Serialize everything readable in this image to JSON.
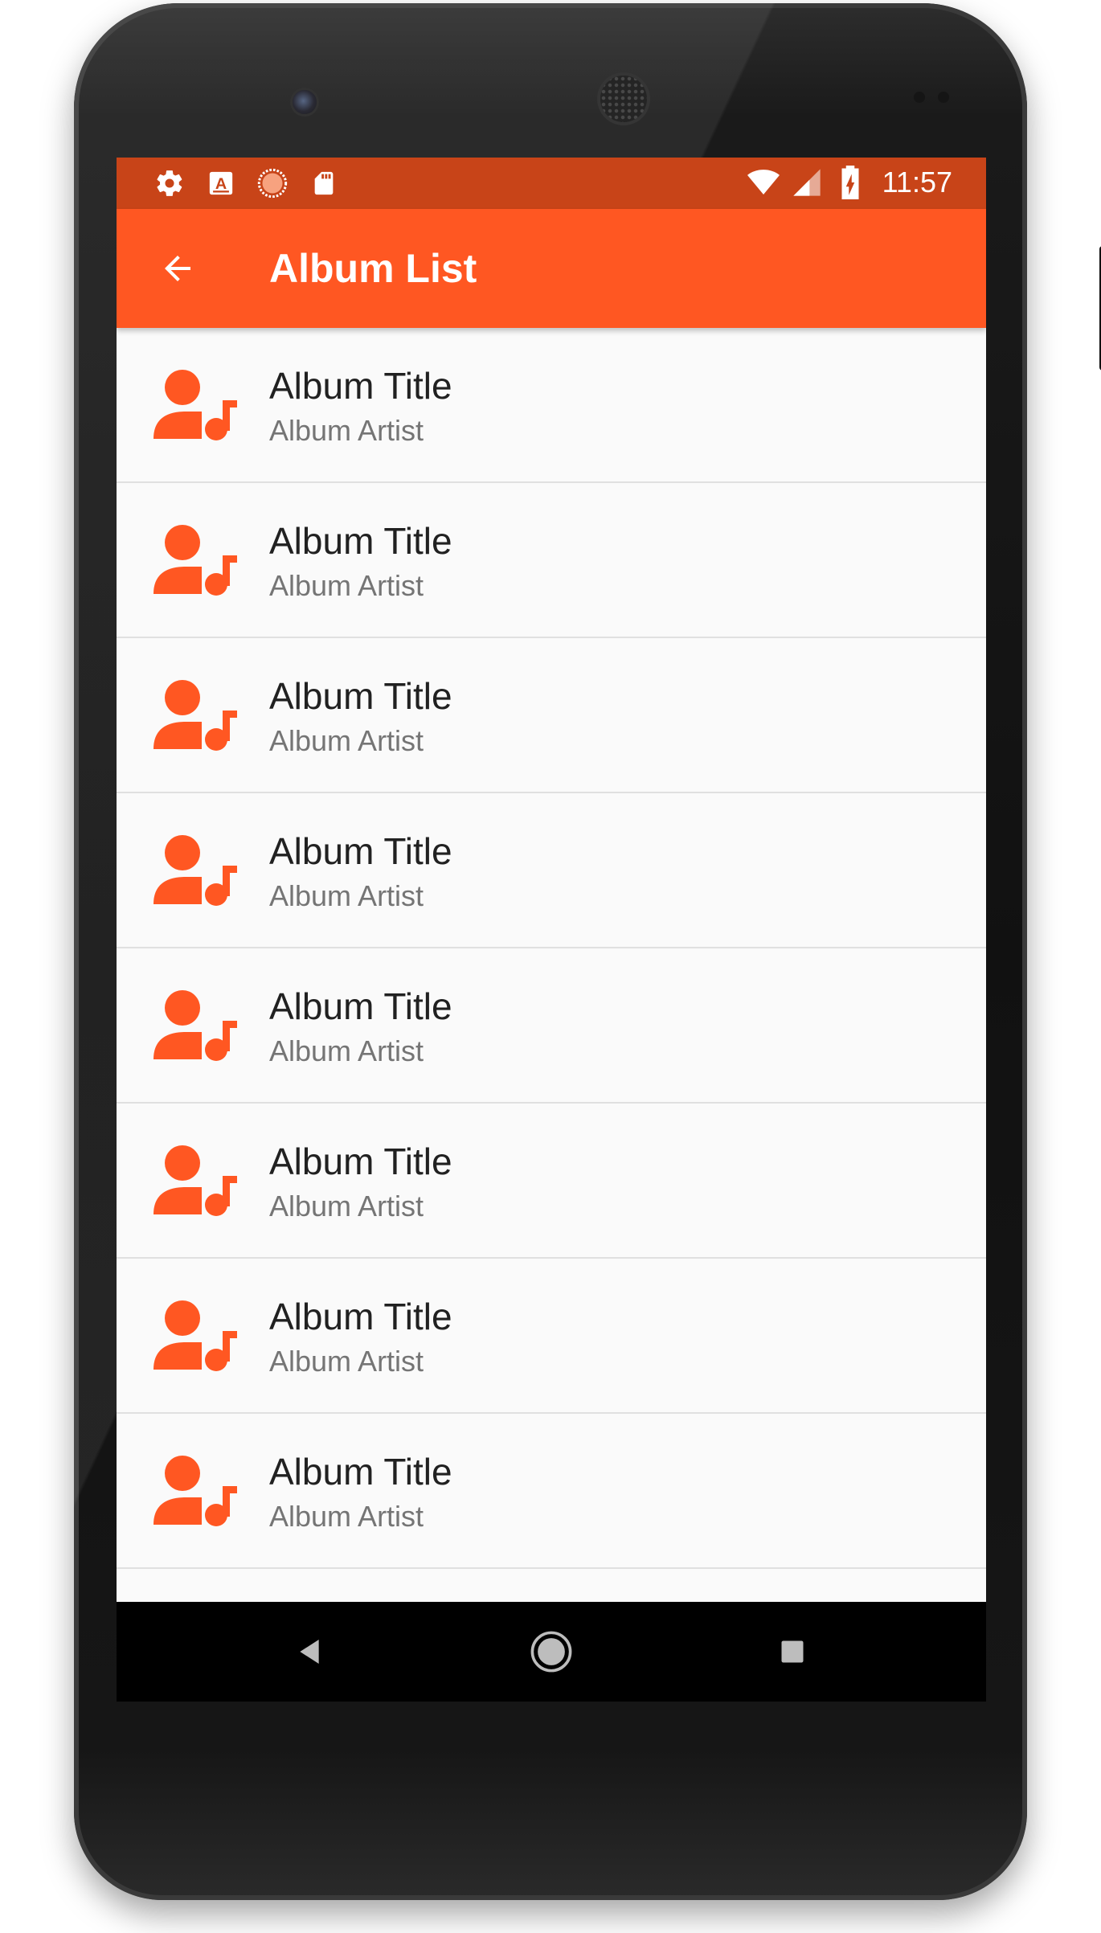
{
  "statusbar": {
    "icons_left": [
      "settings-icon",
      "text-a-icon",
      "sync-icon",
      "sd-card-icon"
    ],
    "icons_right": [
      "wifi-icon",
      "signal-icon",
      "battery-charging-icon"
    ],
    "time": "11:57",
    "color": "#c84418"
  },
  "appbar": {
    "title": "Album List",
    "back_icon": "arrow-back-icon",
    "color": "#ff5722"
  },
  "list": {
    "items": [
      {
        "title": "Album Title",
        "subtitle": "Album Artist",
        "icon": "artist-music-icon"
      },
      {
        "title": "Album Title",
        "subtitle": "Album Artist",
        "icon": "artist-music-icon"
      },
      {
        "title": "Album Title",
        "subtitle": "Album Artist",
        "icon": "artist-music-icon"
      },
      {
        "title": "Album Title",
        "subtitle": "Album Artist",
        "icon": "artist-music-icon"
      },
      {
        "title": "Album Title",
        "subtitle": "Album Artist",
        "icon": "artist-music-icon"
      },
      {
        "title": "Album Title",
        "subtitle": "Album Artist",
        "icon": "artist-music-icon"
      },
      {
        "title": "Album Title",
        "subtitle": "Album Artist",
        "icon": "artist-music-icon"
      },
      {
        "title": "Album Title",
        "subtitle": "Album Artist",
        "icon": "artist-music-icon"
      }
    ]
  },
  "navbar": {
    "buttons": [
      "back-triangle-icon",
      "home-circle-icon",
      "recents-square-icon"
    ]
  }
}
